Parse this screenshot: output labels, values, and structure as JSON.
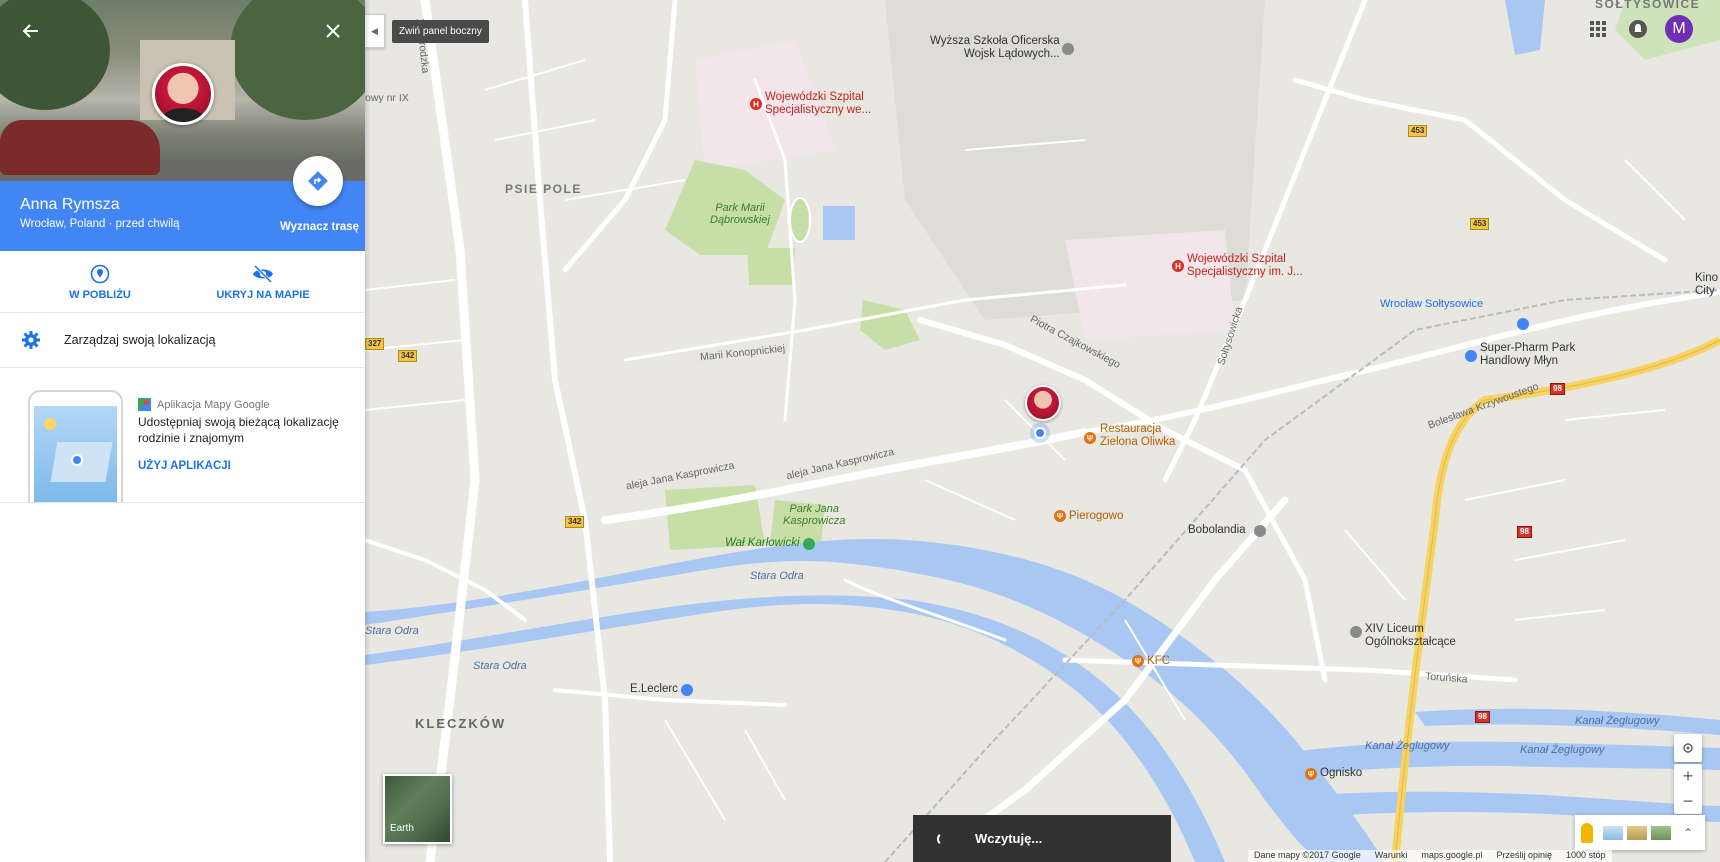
{
  "sidebar": {
    "name": "Anna Rymsza",
    "subtitle": "Wrocław, Poland · przed chwilą",
    "route_label": "Wyznacz trasę",
    "actions": [
      {
        "label": "W POBLIŻU",
        "icon": "location-pin-icon"
      },
      {
        "label": "UKRYJ NA MAPIE",
        "icon": "eye-off-icon"
      }
    ],
    "manage_label": "Zarządzaj swoją lokalizacją",
    "promo": {
      "app_name": "Aplikacja Mapy Google",
      "text": "Udostępniaj swoją bieżącą lokalizację rodzinie i znajomym",
      "cta": "UŻYJ APLIKACJI"
    }
  },
  "tooltip": "Zwiń panel boczny",
  "user_initial": "M",
  "map": {
    "labels": {
      "psie_pole": "PSIE POLE",
      "kleczkow": "KLECZKÓW",
      "park_marii": "Park Marii\nDąbrowskiej",
      "park_jana": "Park Jana\nKasprowicza",
      "wal": "Wał Karłowicki",
      "szpital1": "Wojewódzki Szpital\nSpecjalistyczny we...",
      "szpital2": "Wojewódzki Szpital\nSpecjalistyczny im. J...",
      "szkola": "Wyższa Szkoła Oficerska\nWojsk Lądowych...",
      "restauracja": "Restauracja\nZielona Oliwka",
      "pierogowo": "Pierogowo",
      "bobolandia": "Bobolandia",
      "kfc": "KFC",
      "leclerc": "E.Leclerc",
      "ognisko": "Ognisko",
      "liceum": "XIV Liceum\nOgólnokształcące",
      "superpharm": "Super-Pharm Park\nHandlowy Młyn",
      "soltysowice_station": "Wrocław Sołtysowice",
      "soltysowice": "SOŁTYSOWICE",
      "kino": "Kino\nCity",
      "stara_odra": "Stara Odra",
      "kanal": "Kanał Żeglugowy",
      "kasprowicza": "aleja Jana Kasprowicza",
      "czajkowskiego": "Piotra Czajkowskiego",
      "konopnickiej": "Marii Konopnickiej",
      "zmigrodzka": "Żmigrodzka",
      "krzywoustego": "Bolesława Krzywoustego",
      "soltysowicka": "Sołtysowicka",
      "torunska": "Toruńska",
      "ix_suffix": "owy nr IX"
    }
  },
  "loading": "Wczytuję...",
  "earth_label": "Earth",
  "footer": {
    "copyright": "Dane mapy ©2017 Google",
    "terms": "Warunki",
    "site": "maps.google.pl",
    "feedback": "Prześlij opinię",
    "scale": "1000 stóp"
  },
  "road_numbers": [
    "453",
    "453",
    "327",
    "342",
    "342",
    "98",
    "98",
    "98"
  ],
  "colors": {
    "accent": "#4285f4",
    "avatar": "#6f2fb5"
  }
}
